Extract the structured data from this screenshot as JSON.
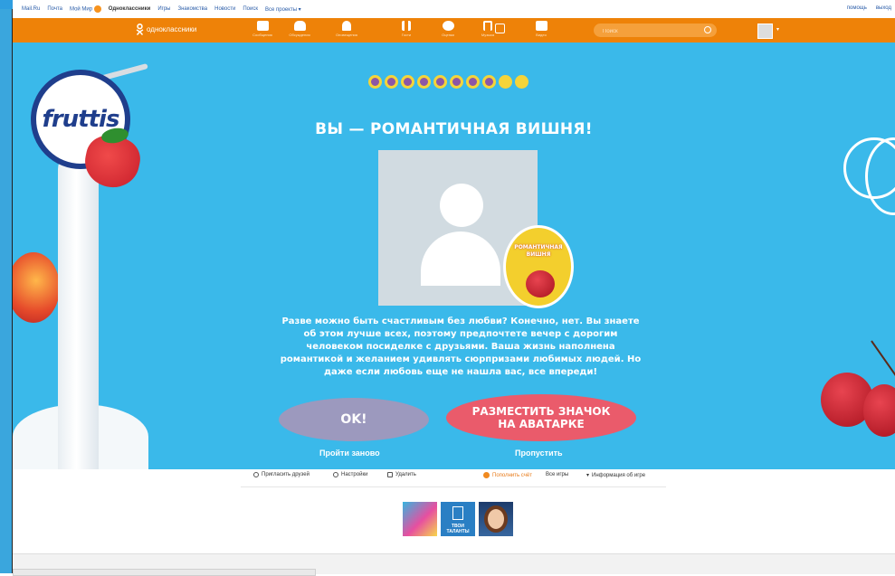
{
  "topbar": {
    "links": [
      "Mail.Ru",
      "Почта",
      "Мой Мир",
      "Одноклассники",
      "Игры",
      "Знакомства",
      "Новости",
      "Поиск",
      "Все проекты ▾"
    ],
    "right": [
      "помощь",
      "выход"
    ]
  },
  "ok": {
    "brand": "одноклассники",
    "nav": [
      {
        "label": "Сообщения",
        "icon": "mail-icon"
      },
      {
        "label": "Обсуждения",
        "icon": "discussion-icon"
      },
      {
        "label": "Оповещения",
        "icon": "bell-icon"
      },
      {
        "label": "Гости",
        "icon": "footprints-icon"
      },
      {
        "label": "Оценки",
        "icon": "ratings-icon"
      },
      {
        "label": "Музыка",
        "icon": "music-icon"
      },
      {
        "label": "Видео",
        "icon": "video-icon"
      }
    ],
    "search_placeholder": "Поиск"
  },
  "game": {
    "logo": "fruttis",
    "progress": {
      "total": 10,
      "filled": 8
    },
    "title": "ВЫ — РОМАНТИЧНАЯ ВИШНЯ!",
    "badge_text": "РОМАНТИЧНАЯ ВИШНЯ",
    "description": "Разве можно быть счастливым без любви? Конечно, нет. Вы знаете об этом лучше всех, поэтому предпочтете вечер с дорогим человеком посиделке с друзьями. Ваша жизнь наполнена романтикой и желанием удивлять сюрпризами любимых людей. Но даже если любовь еще не нашла вас, все впереди!",
    "btn_ok": "OK!",
    "btn_place": "РАЗМЕСТИТЬ ЗНАЧОК НА АВАТАРКЕ",
    "link_retry": "Пройти заново",
    "link_skip": "Пропустить"
  },
  "app_footer": {
    "invite": "Пригласить друзей",
    "settings": "Настройки",
    "delete": "Удалить",
    "fill": "Пополнить счёт",
    "all_games": "Все игры",
    "info": "Информация об игре"
  },
  "thumbs": [
    {
      "name": "thumb-fruttis"
    },
    {
      "name": "thumb-talents",
      "label": "ТВОИ ТАЛАНТЫ"
    },
    {
      "name": "thumb-girl"
    }
  ],
  "colors": {
    "orange": "#ee8208",
    "game_bg": "#3ab9ea",
    "ok_btn": "#9c99be",
    "place_btn": "#ea5b6b",
    "dot_yellow": "#f4d43a",
    "dot_purple": "#8c56a6"
  }
}
